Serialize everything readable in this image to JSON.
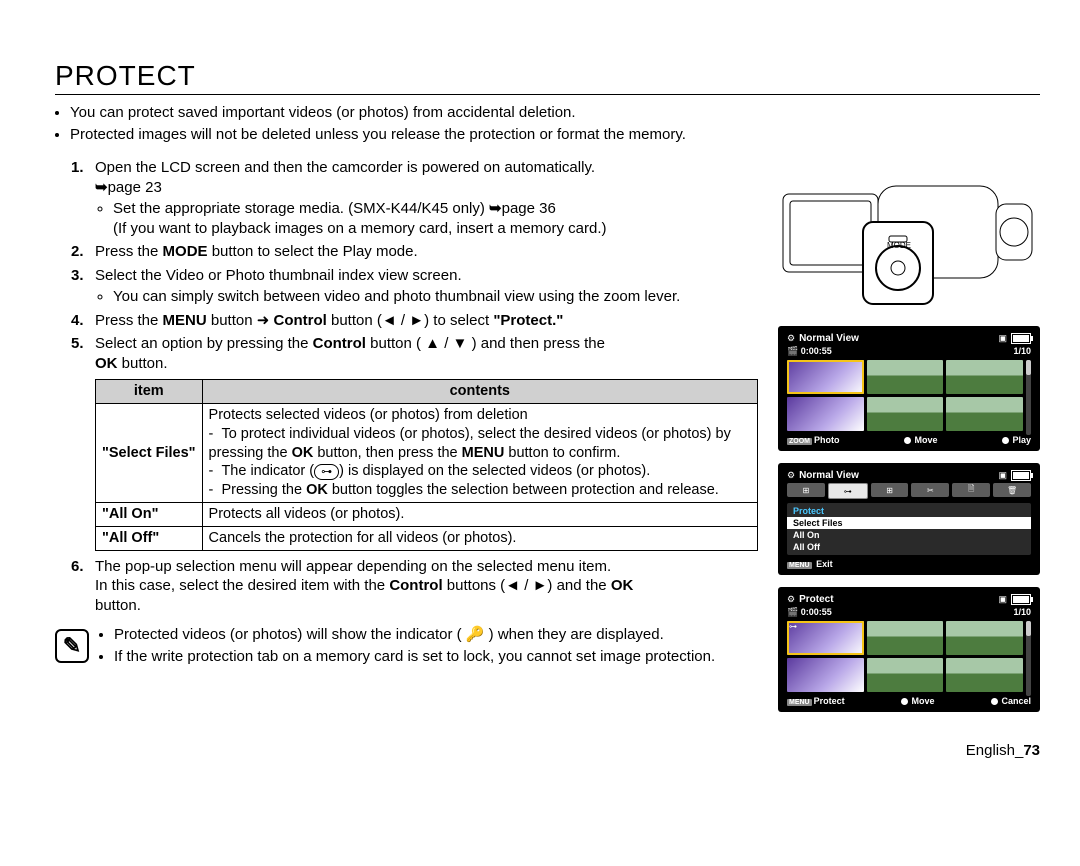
{
  "title": "PROTECT",
  "intro": [
    "You can protect saved important videos (or photos) from accidental deletion.",
    "Protected images will not be deleted unless you release the protection or format the memory."
  ],
  "steps": {
    "s1_a": "Open the LCD screen and then the camcorder is powered on automatically.",
    "s1_page": "page 23",
    "s1_b1": "Set the appropriate storage media. (SMX-K44/K45 only) ",
    "s1_b1_page": "page 36",
    "s1_b2": "(If you want to playback images on a memory card, insert a memory card.)",
    "s2_a": "Press the ",
    "s2_mode": "MODE",
    "s2_b": " button to select the Play mode.",
    "s3": "Select the Video or Photo thumbnail index view screen.",
    "s3_sub": "You can simply switch between video and photo thumbnail view using the zoom lever.",
    "s4_a": "Press the ",
    "s4_menu": "MENU",
    "s4_b": " button ",
    "s4_c": " Control",
    "s4_d": " button (",
    "s4_e": ") to select ",
    "s4_protect": "\"Protect.\"",
    "s5_a": "Select an option by pressing the ",
    "s5_control": "Control",
    "s5_b": " button ( ",
    "s5_c": " ) and then press the ",
    "s5_ok": "OK",
    "s5_d": " button.",
    "s6_a": "The pop-up selection menu will appear depending on the selected menu item.",
    "s6_b1": "In this case, select the desired item with the ",
    "s6_control": "Control",
    "s6_b2": " buttons (",
    "s6_b3": ") and the ",
    "s6_ok": "OK",
    "s6_b4": " button."
  },
  "table": {
    "h_item": "item",
    "h_contents": "contents",
    "r1_item": "\"Select Files\"",
    "r1_l1": "Protects selected videos (or photos) from deletion",
    "r1_l2a": "To protect individual videos (or photos), select the desired videos (or photos) by pressing the ",
    "r1_l2_ok": "OK",
    "r1_l2b": " button, then press the ",
    "r1_l2_menu": "MENU",
    "r1_l2c": " button to confirm.",
    "r1_l3a": "The indicator (",
    "r1_l3b": ") is displayed on the selected videos (or photos).",
    "r1_l4a": "Pressing the ",
    "r1_l4_ok": "OK",
    "r1_l4b": " button toggles the selection between protection and release.",
    "r2_item": "\"All On\"",
    "r2_desc": "Protects all videos (or photos).",
    "r3_item": "\"All Off\"",
    "r3_desc": "Cancels the protection for all videos (or photos)."
  },
  "notes": [
    "Protected videos (or photos) will show the indicator ( 🔑 ) when they are displayed.",
    "If the write protection tab on a memory card is set to lock, you cannot set image protection."
  ],
  "footer": {
    "lang": "English_",
    "page": "73"
  },
  "screens": {
    "mode_label": "MODE",
    "s1": {
      "title": "Normal View",
      "time": "0:00:55",
      "count": "1/10",
      "foot_left_prefix": "ZOOM",
      "foot_left": "Photo",
      "foot_mid": "Move",
      "foot_right": "Play"
    },
    "s2": {
      "title": "Normal View",
      "menu_title": "Protect",
      "opt1": "Select Files",
      "opt2": "All On",
      "opt3": "All Off",
      "foot_prefix": "MENU",
      "foot": "Exit"
    },
    "s3": {
      "title": "Protect",
      "time": "0:00:55",
      "count": "1/10",
      "foot_left_prefix": "MENU",
      "foot_left": "Protect",
      "foot_mid": "Move",
      "foot_right": "Cancel"
    }
  }
}
